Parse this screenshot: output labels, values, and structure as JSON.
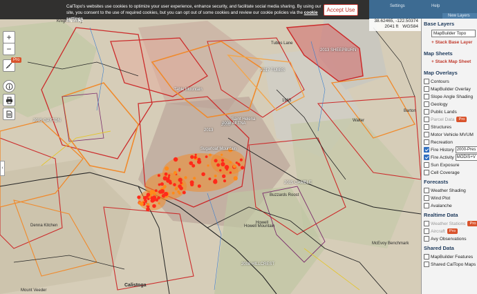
{
  "cookie": {
    "text": "CalTopo's websites use cookies to optimize your user experience, enhance security, and facilitate social media sharing. By using our site, you consent to the use of required cookies, but you can opt out of some cookies and review our cookie policies via the",
    "policy_link": "cookie settings",
    "accept_label": "Accept Use"
  },
  "header": {
    "settings_label": "Settings",
    "help_label": "Help",
    "new_layers_label": "New Layers",
    "coords": "38.62465, -122.50374",
    "elevation": "2041 ft",
    "datum": "WGS84"
  },
  "controls": {
    "zoom_in": "+",
    "zoom_out": "−",
    "pro_badge": "Pro"
  },
  "panel": {
    "base_layers": {
      "title": "Base Layers",
      "selected": "MapBuilder Topo",
      "stack_label": "+ Stack Base Layer"
    },
    "map_sheets": {
      "title": "Map Sheets",
      "stack_label": "+ Stack Map Sheet"
    },
    "map_overlays": {
      "title": "Map Overlays",
      "items": [
        {
          "label": "Contours",
          "checked": false
        },
        {
          "label": "MapBuilder Overlay",
          "checked": false
        },
        {
          "label": "Slope Angle Shading",
          "checked": false
        },
        {
          "label": "Geology",
          "checked": false
        },
        {
          "label": "Public Lands",
          "checked": false
        },
        {
          "label": "Parcel Data",
          "checked": false,
          "pro": "Pro",
          "dim": true
        },
        {
          "label": "Structures",
          "checked": false
        },
        {
          "label": "Motor Vehicle MVUM",
          "checked": false
        },
        {
          "label": "Recreation",
          "checked": false
        },
        {
          "label": "Fire History",
          "checked": true,
          "select": "2000-Pres"
        },
        {
          "label": "Fire Activity",
          "checked": true,
          "select": "MODIS+V"
        },
        {
          "label": "Sun Exposure",
          "checked": false
        },
        {
          "label": "Cell Coverage",
          "checked": false
        }
      ]
    },
    "forecasts": {
      "title": "Forecasts",
      "items": [
        {
          "label": "Weather Shading",
          "checked": false
        },
        {
          "label": "Wind Plot",
          "checked": false
        },
        {
          "label": "Avalanche",
          "checked": false
        }
      ]
    },
    "realtime": {
      "title": "Realtime Data",
      "items": [
        {
          "label": "Weather Stations",
          "checked": false,
          "pro": "Pro",
          "dim": true
        },
        {
          "label": "Aircraft",
          "checked": false,
          "pro": "Pro",
          "dim": true
        },
        {
          "label": "Avy Observations",
          "checked": false
        }
      ]
    },
    "shared": {
      "title": "Shared Data",
      "items": [
        {
          "label": "MapBuilder Features",
          "checked": false
        },
        {
          "label": "Shared CalTopo Maps",
          "checked": false
        }
      ]
    }
  },
  "map_labels": [
    {
      "text": "Knights Valley",
      "style": ""
    },
    {
      "text": "Table Mountain",
      "style": "white"
    },
    {
      "text": "Saint Helena",
      "style": "white"
    },
    {
      "text": "Sugarloaf Mountain",
      "style": "white"
    },
    {
      "text": "Calistoga",
      "style": "bold"
    },
    {
      "text": "Howell Mountain",
      "style": ""
    },
    {
      "text": "Buzzards Roost",
      "style": ""
    },
    {
      "text": "Mount Veeder",
      "style": ""
    },
    {
      "text": "1965",
      "style": ""
    },
    {
      "text": "2013",
      "style": "white"
    },
    {
      "text": "2008",
      "style": "white"
    },
    {
      "text": "2017 TUBBS",
      "style": "white"
    },
    {
      "text": "2013 SHEEPBURN",
      "style": "white"
    },
    {
      "text": "2015 GAYTON",
      "style": "white"
    },
    {
      "text": "2008 AETNA",
      "style": "white"
    },
    {
      "text": "2015 GAMBLE",
      "style": "white"
    },
    {
      "text": "2008 HILLCREST",
      "style": "white"
    },
    {
      "text": "McEvoy Benchmark",
      "style": ""
    },
    {
      "text": "Barton",
      "style": ""
    },
    {
      "text": "Walter",
      "style": ""
    },
    {
      "text": "Denna Kitchen",
      "style": ""
    },
    {
      "text": "Howell",
      "style": ""
    },
    {
      "text": "Tubbs Lane",
      "style": ""
    }
  ],
  "map_colors": {
    "fire_red": "#cc2b2b",
    "fire_orange": "#f08a2c",
    "hotspot": "#ff2a1a",
    "terrain": "#d8cfbd",
    "vegetation": "#b9c4a2",
    "road": "#222222"
  }
}
